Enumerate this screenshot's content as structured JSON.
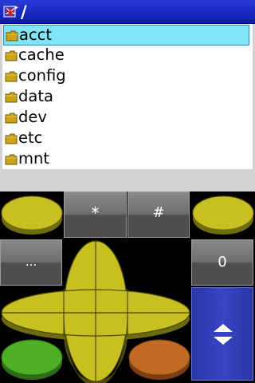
{
  "titlebar": {
    "path": "/",
    "app_icon": "app-bug-icon"
  },
  "file_list": {
    "selected_index": 0,
    "items": [
      {
        "name": "acct",
        "icon": "folder-icon"
      },
      {
        "name": "cache",
        "icon": "folder-icon"
      },
      {
        "name": "config",
        "icon": "folder-icon"
      },
      {
        "name": "data",
        "icon": "folder-icon"
      },
      {
        "name": "dev",
        "icon": "folder-icon"
      },
      {
        "name": "etc",
        "icon": "folder-icon"
      },
      {
        "name": "mnt",
        "icon": "folder-icon"
      }
    ]
  },
  "keypad": {
    "star_label": "*",
    "hash_label": "#",
    "ellipsis_label": "...",
    "zero_label": "0",
    "colors": {
      "yellow_key": "#c8c020",
      "green_key": "#4caf25",
      "orange_key": "#c06a24",
      "blue_key": "#3440b8",
      "gray_key": "#777777"
    }
  }
}
